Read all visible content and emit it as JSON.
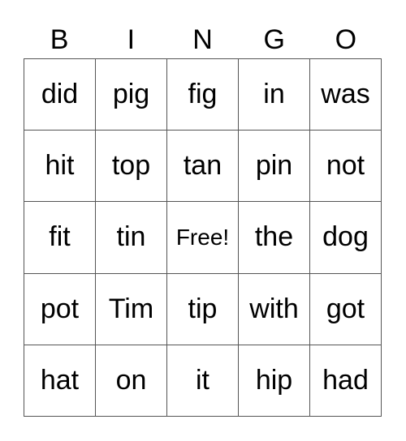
{
  "header": [
    "B",
    "I",
    "N",
    "G",
    "O"
  ],
  "rows": [
    [
      "did",
      "pig",
      "fig",
      "in",
      "was"
    ],
    [
      "hit",
      "top",
      "tan",
      "pin",
      "not"
    ],
    [
      "fit",
      "tin",
      "Free!",
      "the",
      "dog"
    ],
    [
      "pot",
      "Tim",
      "tip",
      "with",
      "got"
    ],
    [
      "hat",
      "on",
      "it",
      "hip",
      "had"
    ]
  ]
}
